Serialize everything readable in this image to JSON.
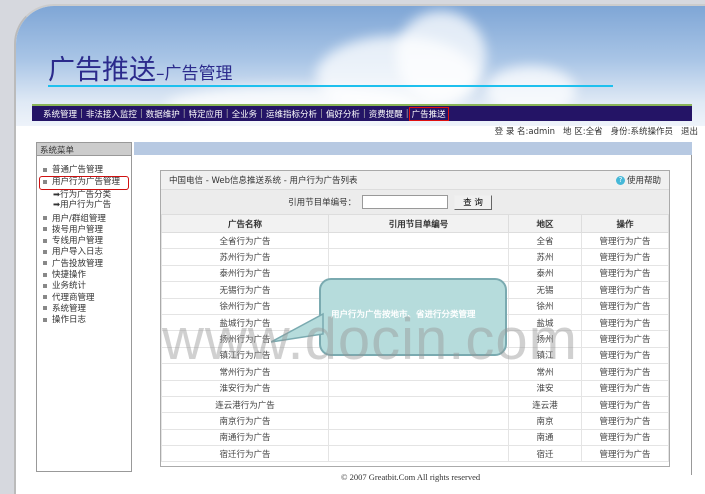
{
  "header": {
    "title": "广告推送",
    "subtitle": "–广告管理"
  },
  "nav": {
    "items": [
      "系统管理",
      "非法接入监控",
      "数据维护",
      "特定应用",
      "全业务",
      "运维指标分析",
      "偏好分析",
      "资费提醒",
      "广告推送"
    ],
    "active": "广告推送"
  },
  "user": {
    "login": "登 录 名:admin",
    "region": "地 区:全省",
    "role": "身份:系统操作员",
    "logout": "退出"
  },
  "sidebar": {
    "title": "系统菜单",
    "items": [
      "普通广告管理",
      "用户行为广告管理"
    ],
    "subitems": [
      "➡行为广告分类",
      "➡用户行为广告"
    ],
    "items2": [
      "用户/群组管理",
      "拨号用户管理",
      "专线用户管理",
      "用户导入日志",
      "广告投放管理",
      "快捷操作",
      "业务统计",
      "代理商管理",
      "系统管理",
      "操作日志"
    ],
    "selected": "用户行为广告管理"
  },
  "panel": {
    "breadcrumb": "中国电信 - Web信息推送系统 - 用户行为广告列表",
    "help": "使用帮助",
    "help_icon": "question-icon",
    "search_label": "引用节目单编号：",
    "search_value": "",
    "search_button": "查 询"
  },
  "table": {
    "columns": [
      "广告名称",
      "引用节目单编号",
      "地区",
      "操作"
    ],
    "rows": [
      [
        "全省行为广告",
        "",
        "全省",
        "管理行为广告"
      ],
      [
        "苏州行为广告",
        "",
        "苏州",
        "管理行为广告"
      ],
      [
        "泰州行为广告",
        "",
        "泰州",
        "管理行为广告"
      ],
      [
        "无锡行为广告",
        "",
        "无锡",
        "管理行为广告"
      ],
      [
        "徐州行为广告",
        "",
        "徐州",
        "管理行为广告"
      ],
      [
        "盐城行为广告",
        "",
        "盐城",
        "管理行为广告"
      ],
      [
        "扬州行为广告",
        "",
        "扬州",
        "管理行为广告"
      ],
      [
        "镇江行为广告",
        "",
        "镇江",
        "管理行为广告"
      ],
      [
        "常州行为广告",
        "",
        "常州",
        "管理行为广告"
      ],
      [
        "淮安行为广告",
        "",
        "淮安",
        "管理行为广告"
      ],
      [
        "连云港行为广告",
        "",
        "连云港",
        "管理行为广告"
      ],
      [
        "南京行为广告",
        "",
        "南京",
        "管理行为广告"
      ],
      [
        "南通行为广告",
        "",
        "南通",
        "管理行为广告"
      ],
      [
        "宿迁行为广告",
        "",
        "宿迁",
        "管理行为广告"
      ]
    ]
  },
  "callout": "用户行为广告按地市、省进行分类管理",
  "watermark": "www.docin.com",
  "footer": "© 2007 Greatbit.Com All rights reserved",
  "colors": {
    "nav_bg": "#241466",
    "title": "#2b2a8c",
    "accent_line": "#1ec0ee",
    "highlight": "#e01010"
  }
}
